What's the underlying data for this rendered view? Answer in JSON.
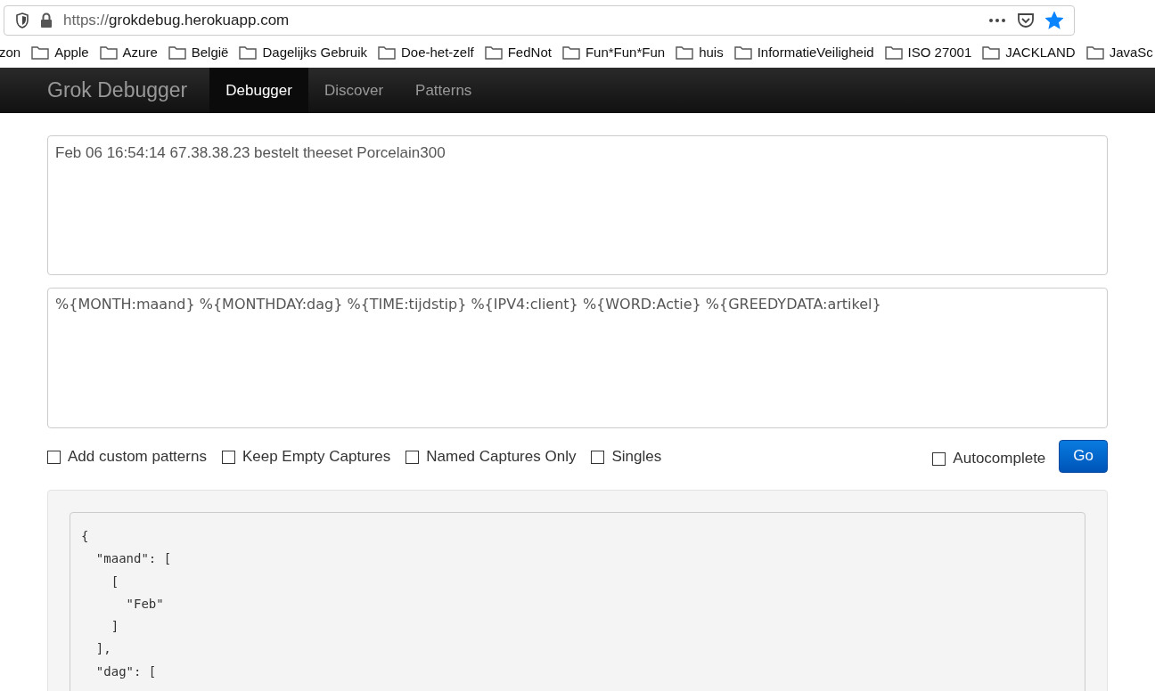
{
  "browser": {
    "url_scheme": "https://",
    "url_host": "grokdebug.herokuapp.com",
    "bookmarked": true,
    "bookmarks": [
      "zon",
      "Apple",
      "Azure",
      "België",
      "Dagelijks Gebruik",
      "Doe-het-zelf",
      "FedNot",
      "Fun*Fun*Fun",
      "huis",
      "InformatieVeiligheid",
      "ISO 27001",
      "JACKLAND",
      "JavaSc"
    ]
  },
  "navbar": {
    "brand": "Grok Debugger",
    "tabs": [
      {
        "label": "Debugger",
        "selected": true
      },
      {
        "label": "Discover",
        "selected": false
      },
      {
        "label": "Patterns",
        "selected": false
      }
    ]
  },
  "input": {
    "value": "Feb 06 16:54:14 67.38.38.23 bestelt theeset Porcelain300"
  },
  "pattern": {
    "value": "%{MONTH:maand} %{MONTHDAY:dag} %{TIME:tijdstip} %{IPV4:client} %{WORD:Actie} %{GREEDYDATA:artikel}"
  },
  "options": [
    {
      "label": "Add custom patterns",
      "checked": false
    },
    {
      "label": "Keep Empty Captures",
      "checked": false
    },
    {
      "label": "Named Captures Only",
      "checked": false
    },
    {
      "label": "Singles",
      "checked": false
    }
  ],
  "autocomplete": {
    "label": "Autocomplete",
    "checked": false
  },
  "go_button": "Go",
  "output": {
    "lines": [
      "{",
      "  \"maand\": [",
      "    [",
      "      \"Feb\"",
      "    ]",
      "  ],",
      "  \"dag\": ["
    ]
  }
}
